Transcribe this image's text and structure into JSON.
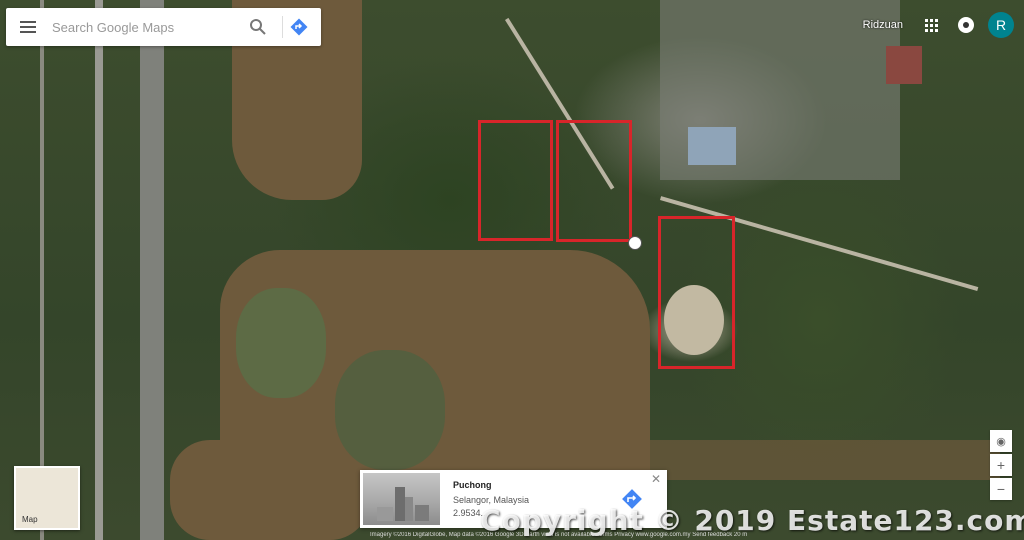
{
  "search": {
    "placeholder": "Search Google Maps"
  },
  "header": {
    "user_name": "Ridzuan",
    "avatar_letter": "R"
  },
  "minimap": {
    "label": "Map"
  },
  "controls": {
    "compass": "◉",
    "zoom_in": "+",
    "zoom_out": "−"
  },
  "place_card": {
    "name": "Puchong",
    "region": "Selangor, Malaysia",
    "coordinates": "2.9534...",
    "close_symbol": "✕"
  },
  "watermark": {
    "text": "Copyright © 2019 Estate123.com"
  },
  "footer": {
    "text": "Imagery ©2016 DigitalGlobe, Map data ©2016 Google    3D Earth view is not available    Terms    Privacy    www.google.com.my    Send feedback    20 m"
  },
  "colors": {
    "highlight": "#d8252a",
    "directions": "#4285f4",
    "avatar": "#00838f"
  },
  "icons": [
    "menu-icon",
    "search-icon",
    "directions-icon",
    "apps-grid-icon",
    "notifications-icon",
    "compass-icon",
    "zoom-in-icon",
    "zoom-out-icon",
    "close-icon"
  ]
}
